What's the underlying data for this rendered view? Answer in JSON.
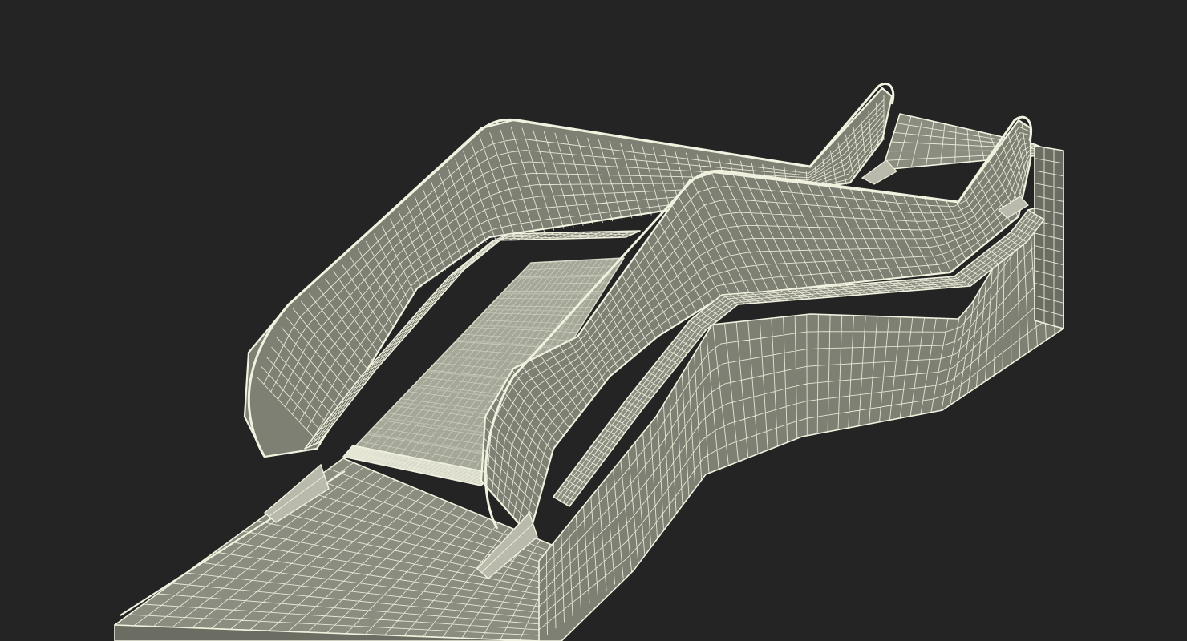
{
  "scene": {
    "subject": "escalator-wireframe-render",
    "colors": {
      "background": "#242424",
      "surface": "#7e8074",
      "surface_dark": "#6b6d62",
      "surface_light": "#8b8d80",
      "steps": "#a5a799",
      "steps_light": "#b9baac",
      "wire": "#f1f1df"
    }
  }
}
